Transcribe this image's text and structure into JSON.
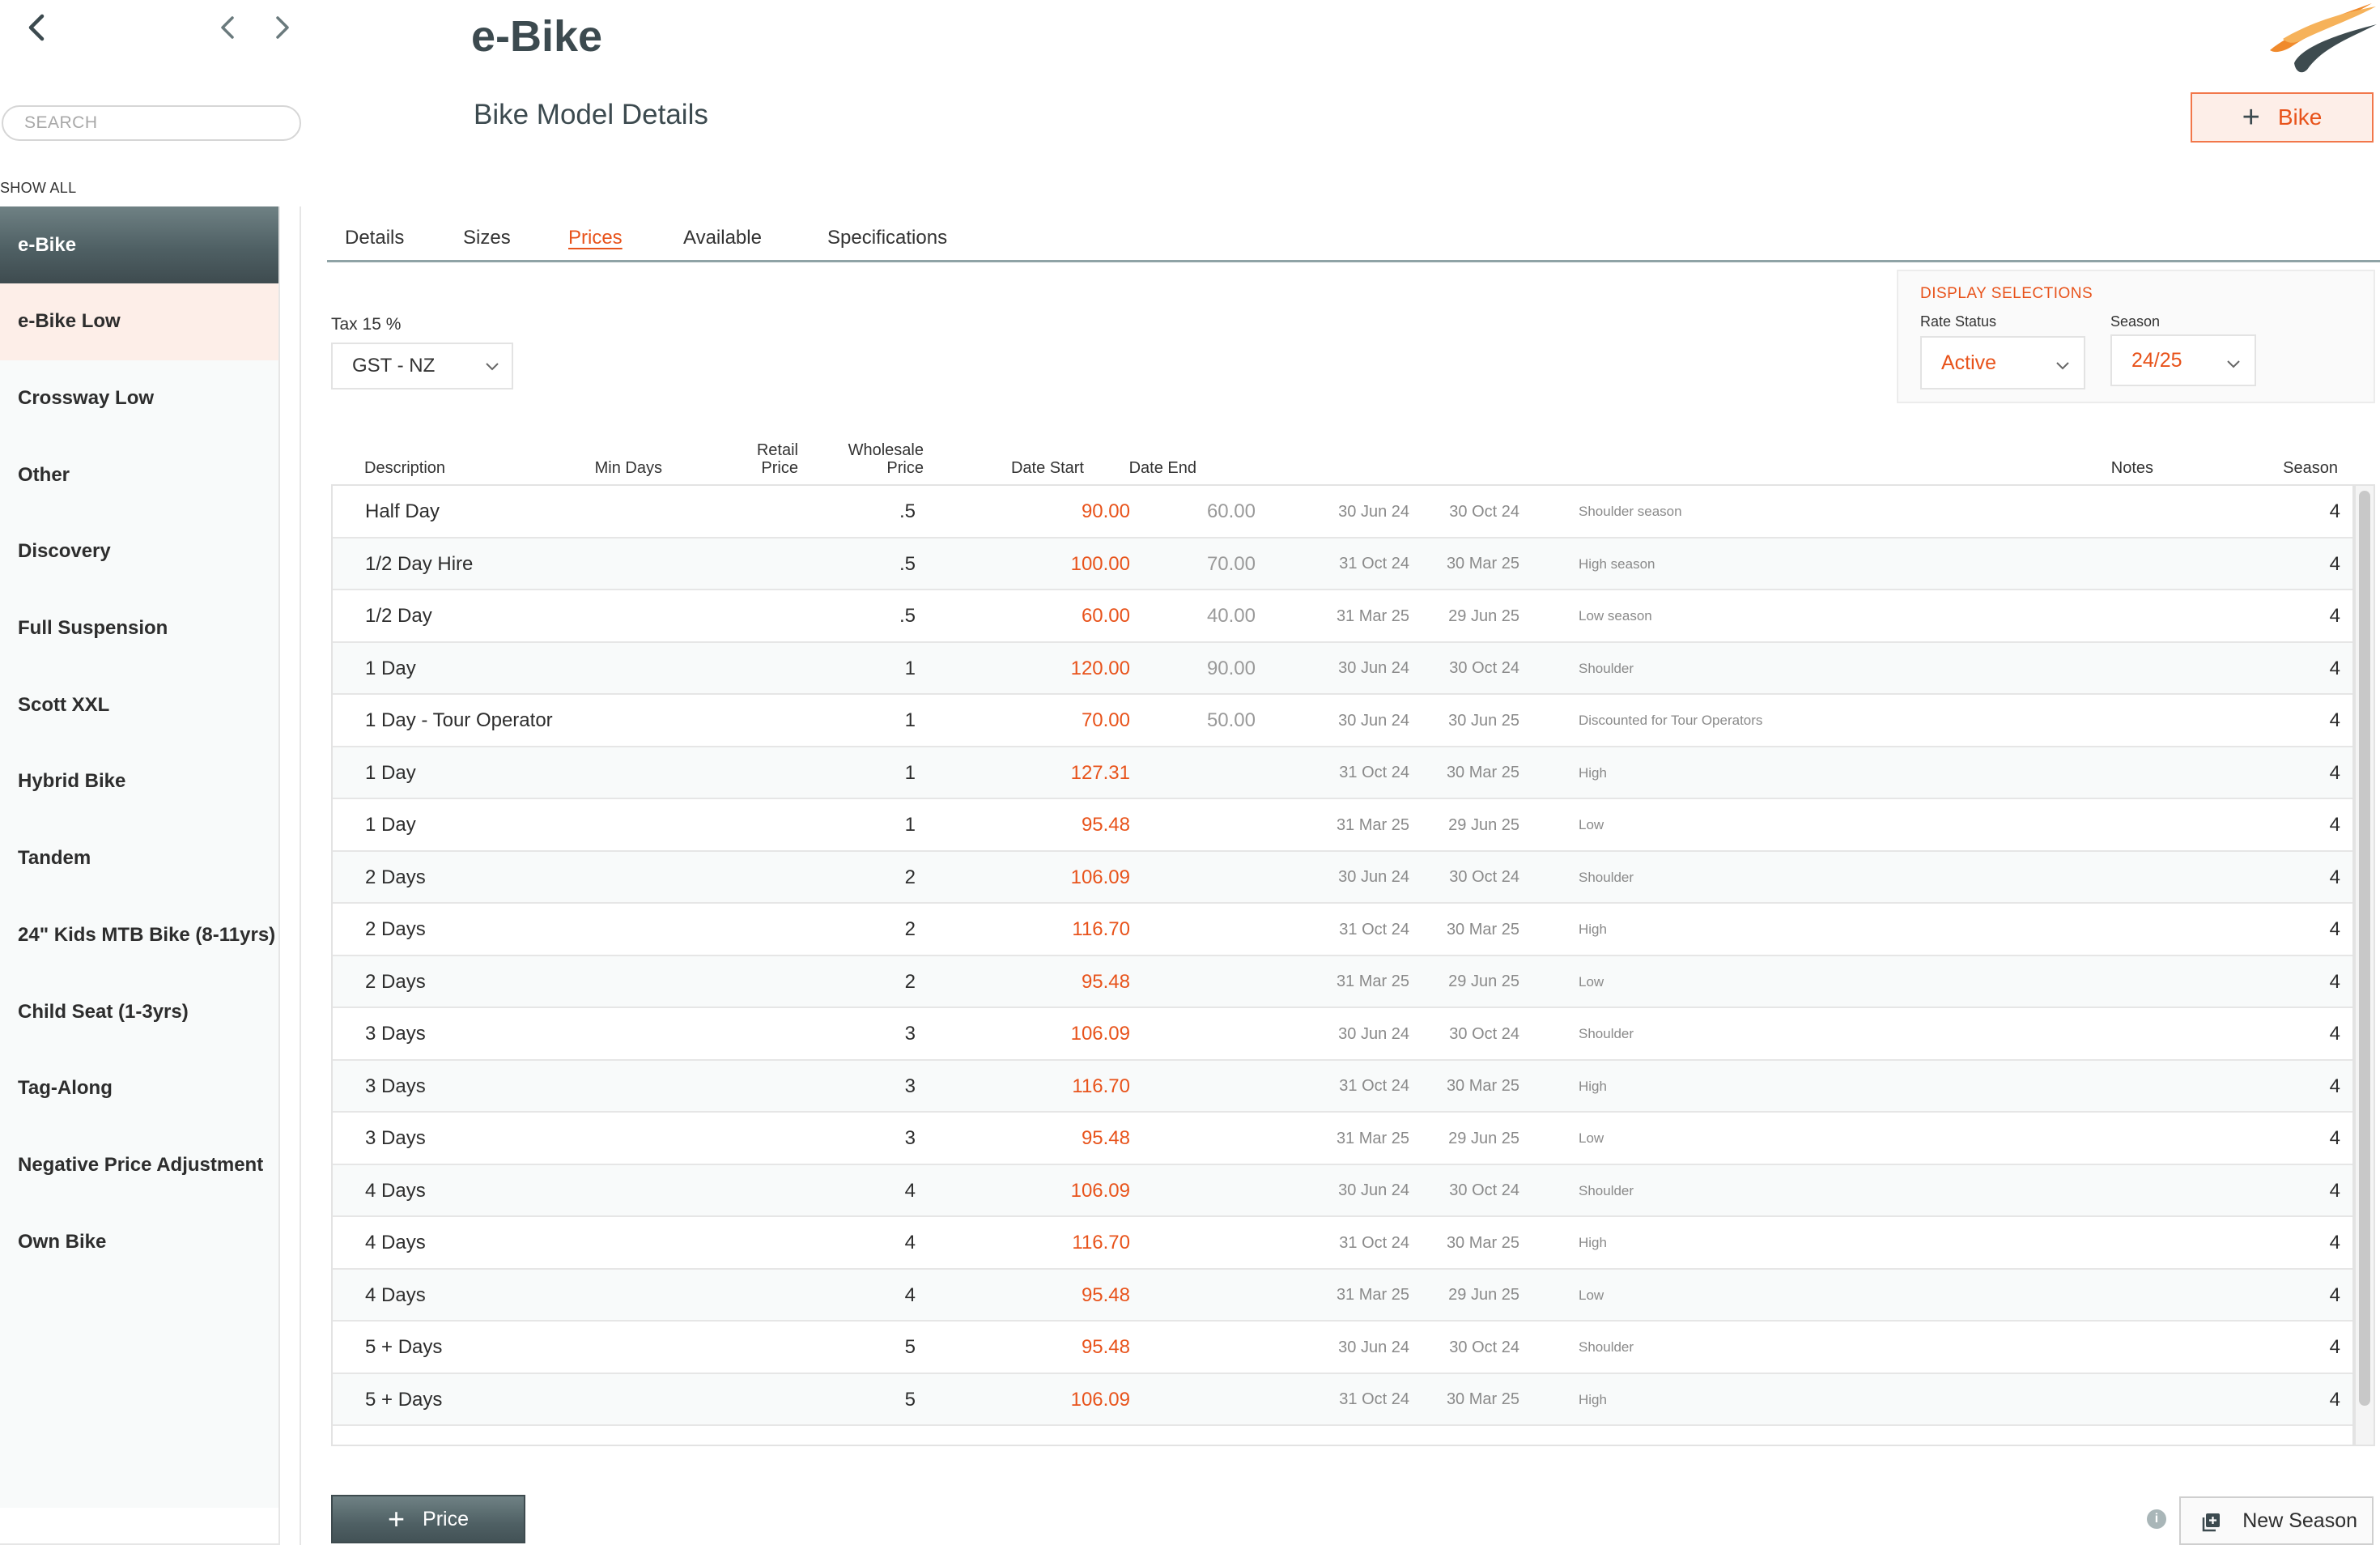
{
  "search": {
    "placeholder": "SEARCH"
  },
  "show_all": "SHOW ALL",
  "sidebar": {
    "items": [
      {
        "label": "e-Bike"
      },
      {
        "label": "e-Bike Low"
      },
      {
        "label": "Crossway Low"
      },
      {
        "label": "Other"
      },
      {
        "label": "Discovery"
      },
      {
        "label": "Full Suspension"
      },
      {
        "label": "Scott XXL"
      },
      {
        "label": "Hybrid Bike"
      },
      {
        "label": "Tandem"
      },
      {
        "label": "24\" Kids MTB Bike (8-11yrs)"
      },
      {
        "label": "Child Seat (1-3yrs)"
      },
      {
        "label": "Tag-Along"
      },
      {
        "label": "Negative Price Adjustment"
      },
      {
        "label": "Own Bike"
      }
    ],
    "active_index": 0
  },
  "header": {
    "title": "e-Bike",
    "subtitle": "Bike Model Details",
    "add_button": "Bike"
  },
  "tabs": [
    {
      "label": "Details"
    },
    {
      "label": "Sizes"
    },
    {
      "label": "Prices",
      "active": true
    },
    {
      "label": "Available"
    },
    {
      "label": "Specifications"
    }
  ],
  "tax": {
    "label": "Tax  15 %",
    "selected": "GST - NZ"
  },
  "display_selections": {
    "title": "DISPLAY SELECTIONS",
    "rate_status_label": "Rate Status",
    "rate_status_value": "Active",
    "season_label": "Season",
    "season_value": "24/25"
  },
  "table": {
    "headers": {
      "description": "Description",
      "min_days": "Min Days",
      "retail_1": "Retail",
      "retail_2": "Price",
      "wholesale_1": "Wholesale",
      "wholesale_2": "Price",
      "date_start": "Date Start",
      "date_end": "Date End",
      "notes": "Notes",
      "season": "Season"
    },
    "rows": [
      {
        "description": "Half Day",
        "min_days": ".5",
        "retail": "90.00",
        "wholesale": "60.00",
        "date_start": "30 Jun 24",
        "date_end": "30 Oct 24",
        "notes": "Shoulder season",
        "season": "4"
      },
      {
        "description": "1/2 Day Hire",
        "min_days": ".5",
        "retail": "100.00",
        "wholesale": "70.00",
        "date_start": "31 Oct 24",
        "date_end": "30 Mar 25",
        "notes": "High season",
        "season": "4"
      },
      {
        "description": "1/2 Day",
        "min_days": ".5",
        "retail": "60.00",
        "wholesale": "40.00",
        "date_start": "31 Mar 25",
        "date_end": "29 Jun 25",
        "notes": "Low season",
        "season": "4"
      },
      {
        "description": "1 Day",
        "min_days": "1",
        "retail": "120.00",
        "wholesale": "90.00",
        "date_start": "30 Jun 24",
        "date_end": "30 Oct 24",
        "notes": "Shoulder",
        "season": "4"
      },
      {
        "description": "1 Day - Tour Operator",
        "min_days": "1",
        "retail": "70.00",
        "wholesale": "50.00",
        "date_start": "30 Jun 24",
        "date_end": "30 Jun 25",
        "notes": "Discounted for Tour Operators",
        "season": "4"
      },
      {
        "description": "1 Day",
        "min_days": "1",
        "retail": "127.31",
        "wholesale": "",
        "date_start": "31 Oct 24",
        "date_end": "30 Mar 25",
        "notes": "High",
        "season": "4"
      },
      {
        "description": "1 Day",
        "min_days": "1",
        "retail": "95.48",
        "wholesale": "",
        "date_start": "31 Mar 25",
        "date_end": "29 Jun 25",
        "notes": "Low",
        "season": "4"
      },
      {
        "description": "2 Days",
        "min_days": "2",
        "retail": "106.09",
        "wholesale": "",
        "date_start": "30 Jun 24",
        "date_end": "30 Oct 24",
        "notes": "Shoulder",
        "season": "4"
      },
      {
        "description": "2 Days",
        "min_days": "2",
        "retail": "116.70",
        "wholesale": "",
        "date_start": "31 Oct 24",
        "date_end": "30 Mar 25",
        "notes": "High",
        "season": "4"
      },
      {
        "description": "2 Days",
        "min_days": "2",
        "retail": "95.48",
        "wholesale": "",
        "date_start": "31 Mar 25",
        "date_end": "29 Jun 25",
        "notes": "Low",
        "season": "4"
      },
      {
        "description": "3 Days",
        "min_days": "3",
        "retail": "106.09",
        "wholesale": "",
        "date_start": "30 Jun 24",
        "date_end": "30 Oct 24",
        "notes": "Shoulder",
        "season": "4"
      },
      {
        "description": "3 Days",
        "min_days": "3",
        "retail": "116.70",
        "wholesale": "",
        "date_start": "31 Oct 24",
        "date_end": "30 Mar 25",
        "notes": "High",
        "season": "4"
      },
      {
        "description": "3 Days",
        "min_days": "3",
        "retail": "95.48",
        "wholesale": "",
        "date_start": "31 Mar 25",
        "date_end": "29 Jun 25",
        "notes": "Low",
        "season": "4"
      },
      {
        "description": "4 Days",
        "min_days": "4",
        "retail": "106.09",
        "wholesale": "",
        "date_start": "30 Jun 24",
        "date_end": "30 Oct 24",
        "notes": "Shoulder",
        "season": "4"
      },
      {
        "description": "4 Days",
        "min_days": "4",
        "retail": "116.70",
        "wholesale": "",
        "date_start": "31 Oct 24",
        "date_end": "30 Mar 25",
        "notes": "High",
        "season": "4"
      },
      {
        "description": "4 Days",
        "min_days": "4",
        "retail": "95.48",
        "wholesale": "",
        "date_start": "31 Mar 25",
        "date_end": "29 Jun 25",
        "notes": "Low",
        "season": "4"
      },
      {
        "description": "5 + Days",
        "min_days": "5",
        "retail": "95.48",
        "wholesale": "",
        "date_start": "30 Jun 24",
        "date_end": "30 Oct 24",
        "notes": "Shoulder",
        "season": "4"
      },
      {
        "description": "5 + Days",
        "min_days": "5",
        "retail": "106.09",
        "wholesale": "",
        "date_start": "31 Oct 24",
        "date_end": "30 Mar 25",
        "notes": "High",
        "season": "4"
      }
    ]
  },
  "footer": {
    "add_price": "Price",
    "new_season": "New Season"
  },
  "colors": {
    "accent": "#e8531b",
    "slate": "#4f6064",
    "hover_row": "#fdeee8"
  },
  "icons": {
    "back": "chevron-left-icon",
    "prev": "chevron-left-icon",
    "next": "chevron-right-icon",
    "plus": "plus-icon",
    "info": "info-icon",
    "new_season": "copy-icon",
    "logo": "swoosh-logo"
  }
}
